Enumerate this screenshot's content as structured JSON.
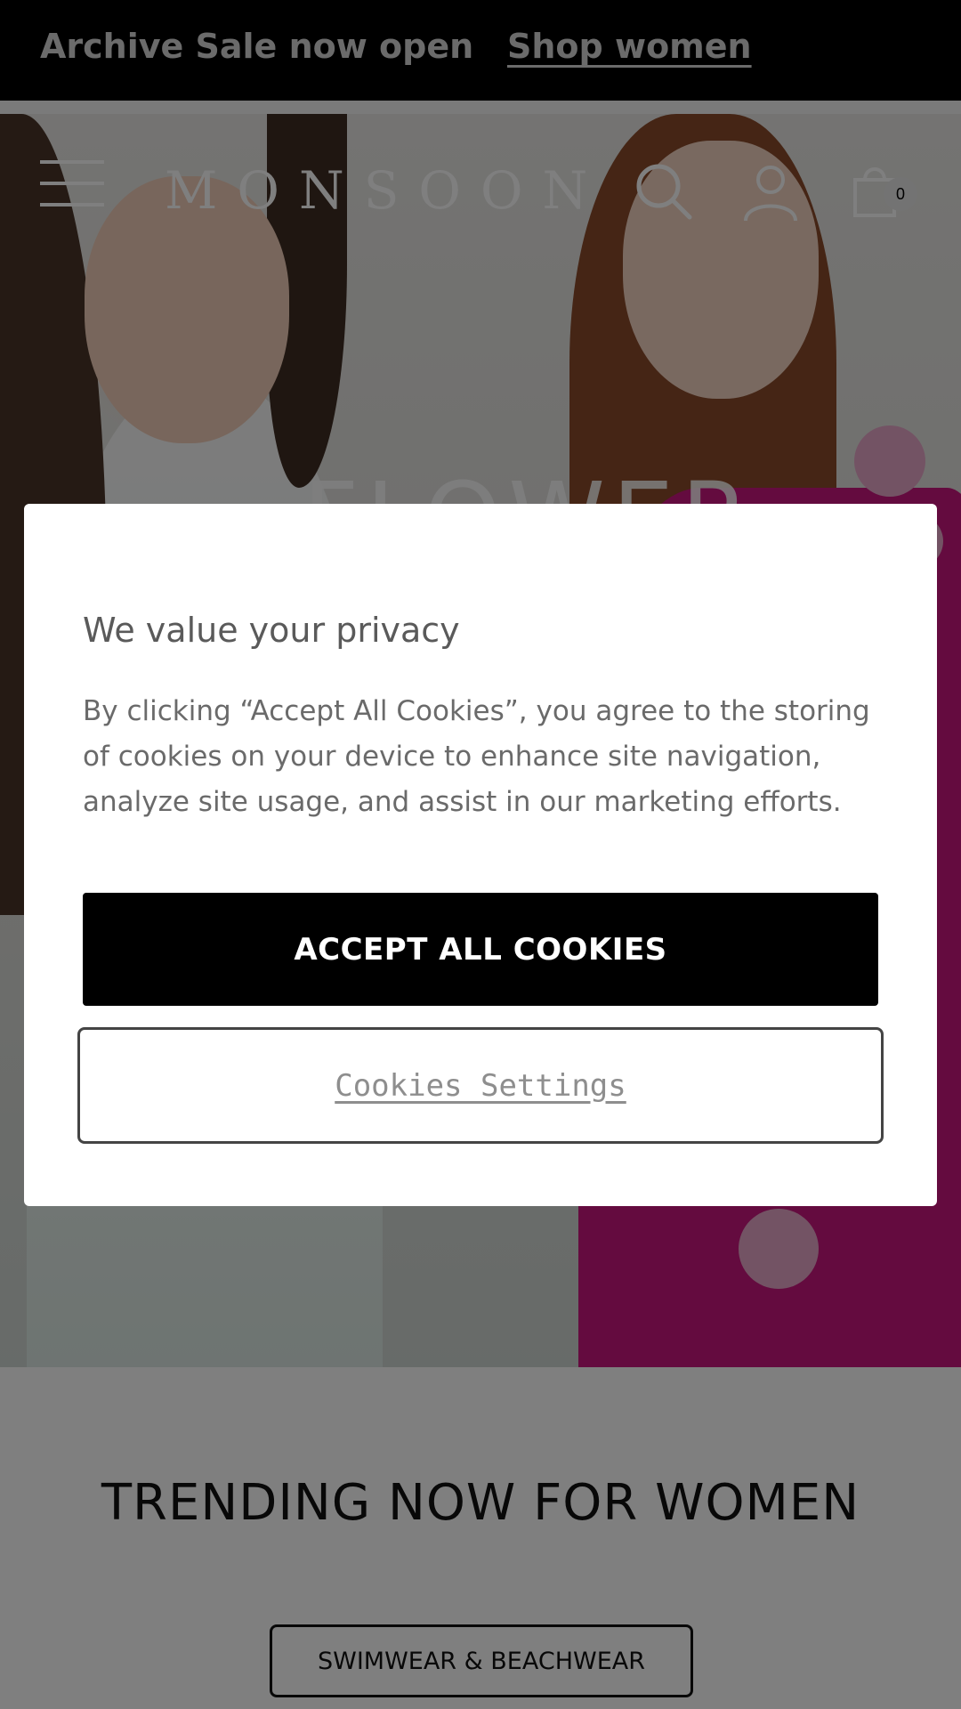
{
  "promo_bar": {
    "message": "Archive Sale now open",
    "link": "Shop women"
  },
  "header": {
    "logo": "MONSOON",
    "bag_count": "0",
    "icons": [
      "menu-icon",
      "search-icon",
      "account-icon",
      "bag-icon"
    ]
  },
  "hero": {
    "title_fragment": "FLOWER",
    "slides_total": 2,
    "active_slide": 1
  },
  "trending": {
    "title": "TRENDING NOW FOR WOMEN",
    "button_label": "SWIMWEAR & BEACHWEAR"
  },
  "cookie_modal": {
    "title": "We value your privacy",
    "body": "By clicking “Accept All Cookies”, you agree to the storing of cookies on your device to enhance site navigation, analyze site usage, and assist in our marketing efforts.",
    "accept_label": "ACCEPT ALL COOKIES",
    "settings_label": "Cookies Settings"
  },
  "colors": {
    "accent": "#000000",
    "dress_pink": "#c8177e",
    "overlay": "rgba(0,0,0,0.5)"
  }
}
